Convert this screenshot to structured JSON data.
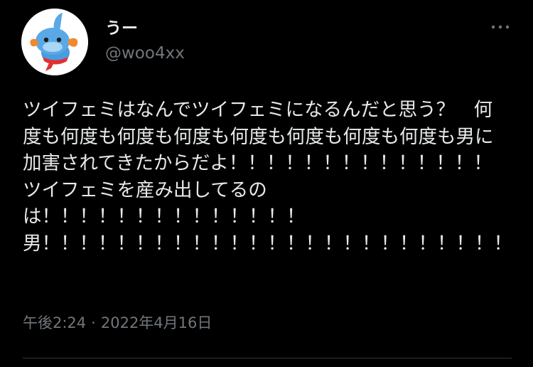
{
  "user": {
    "display_name": "うー",
    "handle": "@woo4xx",
    "avatar_icon": "mudkip-avatar-icon"
  },
  "more_icon": "more-options-icon",
  "tweet": {
    "text": "ツイフェミはなんでツイフェミになるんだと思う？　何度も何度も何度も何度も何度も何度も何度も何度も男に加害されてきたからだよ！！！！！！！！！！！！！！　ツイフェミを産み出してるのは！！！！！！！！！！！！！！\n男！！！！！！！！！！！！！！！！！！！！！！！！！"
  },
  "meta": {
    "time": "午後2:24",
    "separator": "·",
    "date": "2022年4月16日"
  },
  "colors": {
    "background": "#000000",
    "primary_text": "#e7e9ea",
    "secondary_text": "#71767b",
    "divider": "#2f3336"
  }
}
